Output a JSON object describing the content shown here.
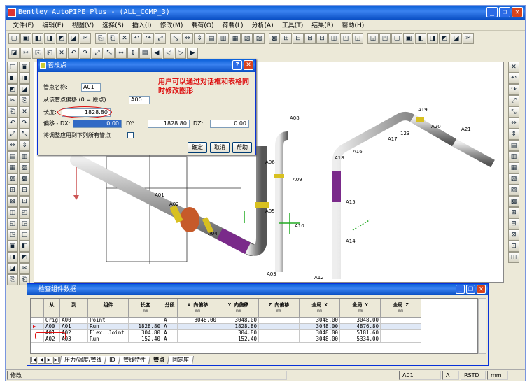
{
  "window": {
    "title": "Bentley AutoPIPE Plus - (ALL_COMP_3)"
  },
  "menu": [
    "文件(F)",
    "编辑(E)",
    "视图(V)",
    "选择(S)",
    "插入(I)",
    "修改(M)",
    "载荷(O)",
    "荷载(L)",
    "分析(A)",
    "工具(T)",
    "结果(R)",
    "帮助(H)"
  ],
  "dialog": {
    "title": "管段点",
    "point_name_label": "管点名称:",
    "point_name_value": "A01",
    "offset_from_label": "从该管点偏移 (0 = 原点):",
    "offset_from_value": "A00",
    "length_label": "长度:",
    "length_value": "1828.80",
    "dx_label": "偏移 - DX:",
    "dx_value": "0.00",
    "dy_label": "DY:",
    "dy_value": "1828.80",
    "dz_label": "DZ:",
    "dz_value": "0.00",
    "apply_label": "将调整应用到下列所有管点",
    "ok": "确定",
    "cancel": "取消",
    "help": "帮助"
  },
  "annotation": "用户可以通过对话框和表格同时修改图形",
  "pipe_labels": [
    "A00",
    "A01",
    "A02",
    "A03",
    "A04",
    "A05",
    "A06",
    "A07",
    "A08",
    "A09",
    "A10",
    "A11",
    "A12",
    "A13",
    "A14",
    "A15",
    "A16",
    "A17",
    "A18",
    "A19",
    "A20",
    "A21",
    "123"
  ],
  "table_window": {
    "title": "检查组件数据",
    "headers": [
      {
        "h": "从",
        "u": ""
      },
      {
        "h": "到",
        "u": ""
      },
      {
        "h": "组件",
        "u": ""
      },
      {
        "h": "长度",
        "u": "mm"
      },
      {
        "h": "分段",
        "u": ""
      },
      {
        "h": "X 向偏移",
        "u": "mm"
      },
      {
        "h": "Y 向偏移",
        "u": "mm"
      },
      {
        "h": "Z 向偏移",
        "u": "mm"
      },
      {
        "h": "全局 X",
        "u": "mm"
      },
      {
        "h": "全局 Y",
        "u": "mm"
      },
      {
        "h": "全局 Z",
        "u": "mm"
      }
    ],
    "rows": [
      [
        "Orig",
        "A00",
        "Point",
        "",
        "A",
        "3048.00",
        "3048.00",
        "",
        "3048.00",
        "3048.00",
        ""
      ],
      [
        "A00",
        "A01",
        "Run",
        "1828.80",
        "A",
        "",
        "1828.80",
        "",
        "3048.00",
        "4876.80",
        ""
      ],
      [
        "A01",
        "A02",
        "Flex. Joint",
        "304.80",
        "A",
        "",
        "304.80",
        "",
        "3048.00",
        "5181.60",
        ""
      ],
      [
        "A02",
        "A03",
        "Run",
        "152.40",
        "A",
        "",
        "152.40",
        "",
        "3048.00",
        "5334.00",
        ""
      ]
    ],
    "tabs": [
      "压力/温度/管线",
      "ID",
      "管线特性",
      "管点",
      "固定座"
    ],
    "active_tab": "管点"
  },
  "status": {
    "left": "修改",
    "point": "A01",
    "seg": "A",
    "std": "RSTD",
    "units": "mm"
  }
}
